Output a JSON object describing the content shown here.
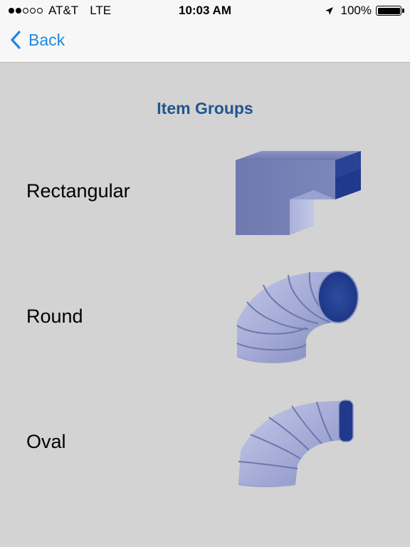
{
  "status_bar": {
    "carrier": "AT&T",
    "network": "LTE",
    "time": "10:03 AM",
    "battery": "100%",
    "signal_bars_filled": 2,
    "signal_bars_total": 5,
    "battery_level": 1.0
  },
  "nav": {
    "back_label": "Back"
  },
  "page": {
    "title": "Item Groups"
  },
  "groups": [
    {
      "label": "Rectangular",
      "icon": "rectangular-duct-elbow-icon"
    },
    {
      "label": "Round",
      "icon": "round-duct-elbow-icon"
    },
    {
      "label": "Oval",
      "icon": "oval-duct-elbow-icon"
    }
  ],
  "colors": {
    "background": "#d3d3d3",
    "bar_background": "#f7f7f7",
    "accent_blue": "#1e88e5",
    "title_blue": "#23558f",
    "duct_blue": "#7b85b8",
    "duct_dark": "#1f3a8a"
  }
}
